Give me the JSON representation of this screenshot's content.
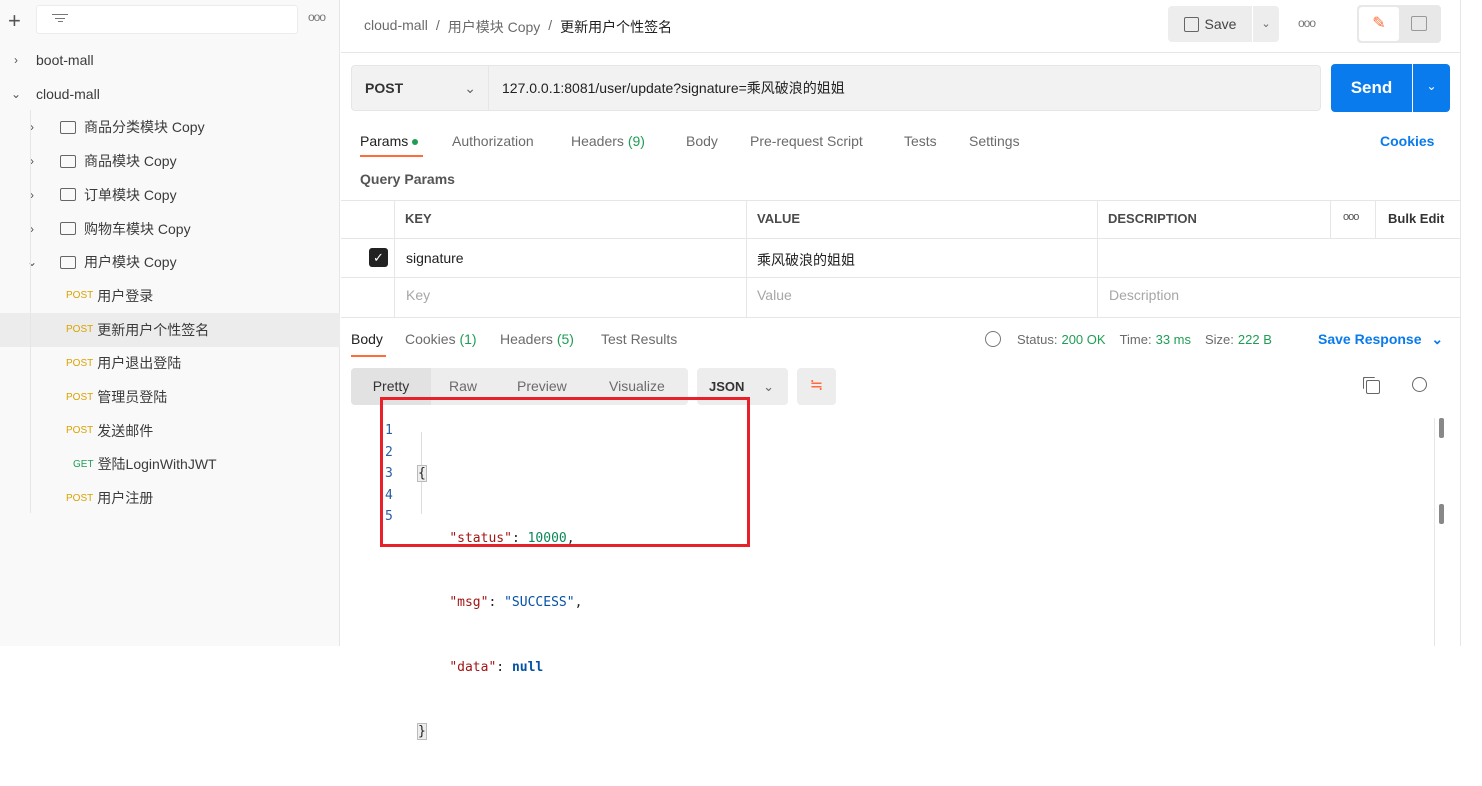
{
  "sidebar": {
    "items": [
      {
        "type": "collection",
        "label": "boot-mall",
        "expanded": false
      },
      {
        "type": "collection",
        "label": "cloud-mall",
        "expanded": true
      },
      {
        "type": "folder",
        "label": "商品分类模块 Copy"
      },
      {
        "type": "folder",
        "label": "商品模块 Copy"
      },
      {
        "type": "folder",
        "label": "订单模块 Copy"
      },
      {
        "type": "folder",
        "label": "购物车模块 Copy"
      },
      {
        "type": "folder",
        "label": "用户模块 Copy",
        "expanded": true
      },
      {
        "type": "request",
        "method": "POST",
        "label": "用户登录"
      },
      {
        "type": "request",
        "method": "POST",
        "label": "更新用户个性签名",
        "selected": true
      },
      {
        "type": "request",
        "method": "POST",
        "label": "用户退出登陆"
      },
      {
        "type": "request",
        "method": "POST",
        "label": "管理员登陆"
      },
      {
        "type": "request",
        "method": "POST",
        "label": "发送邮件"
      },
      {
        "type": "request",
        "method": "GET",
        "label": "登陆LoginWithJWT"
      },
      {
        "type": "request",
        "method": "POST",
        "label": "用户注册"
      }
    ]
  },
  "header": {
    "breadcrumb": [
      "cloud-mall",
      "用户模块 Copy",
      "更新用户个性签名"
    ],
    "sep": "/",
    "save": "Save"
  },
  "request": {
    "method": "POST",
    "url": "127.0.0.1:8081/user/update?signature=乘风破浪的姐姐",
    "send": "Send"
  },
  "tabs": [
    "Params",
    "Authorization",
    "Headers",
    "(9)",
    "Body",
    "Pre-request Script",
    "Tests",
    "Settings"
  ],
  "cookies": "Cookies",
  "query_params_title": "Query Params",
  "table": {
    "headers": [
      "KEY",
      "VALUE",
      "DESCRIPTION"
    ],
    "bulk_edit": "Bulk Edit",
    "rows": [
      {
        "key": "signature",
        "value": "乘风破浪的姐姐",
        "checked": true
      }
    ],
    "placeholders": [
      "Key",
      "Value",
      "Description"
    ]
  },
  "response": {
    "tabs": [
      "Body",
      "Cookies",
      "(1)",
      "Headers",
      "(5)",
      "Test Results"
    ],
    "status_label": "Status:",
    "status": "200 OK",
    "time_label": "Time:",
    "time": "33 ms",
    "size_label": "Size:",
    "size": "222 B",
    "save_response": "Save Response",
    "view_modes": [
      "Pretty",
      "Raw",
      "Preview",
      "Visualize"
    ],
    "format": "JSON",
    "lines": [
      "1",
      "2",
      "3",
      "4",
      "5"
    ],
    "code": {
      "open": "{",
      "k1": "\"status\"",
      "v1": "10000",
      "k2": "\"msg\"",
      "v2": "\"SUCCESS\"",
      "k3": "\"data\"",
      "v3": "null",
      "close": "}"
    }
  },
  "colors": {
    "accent": "#ff6c37",
    "send": "#097bed",
    "status_ok": "#1f9d55",
    "highlight": "#e8202a"
  }
}
